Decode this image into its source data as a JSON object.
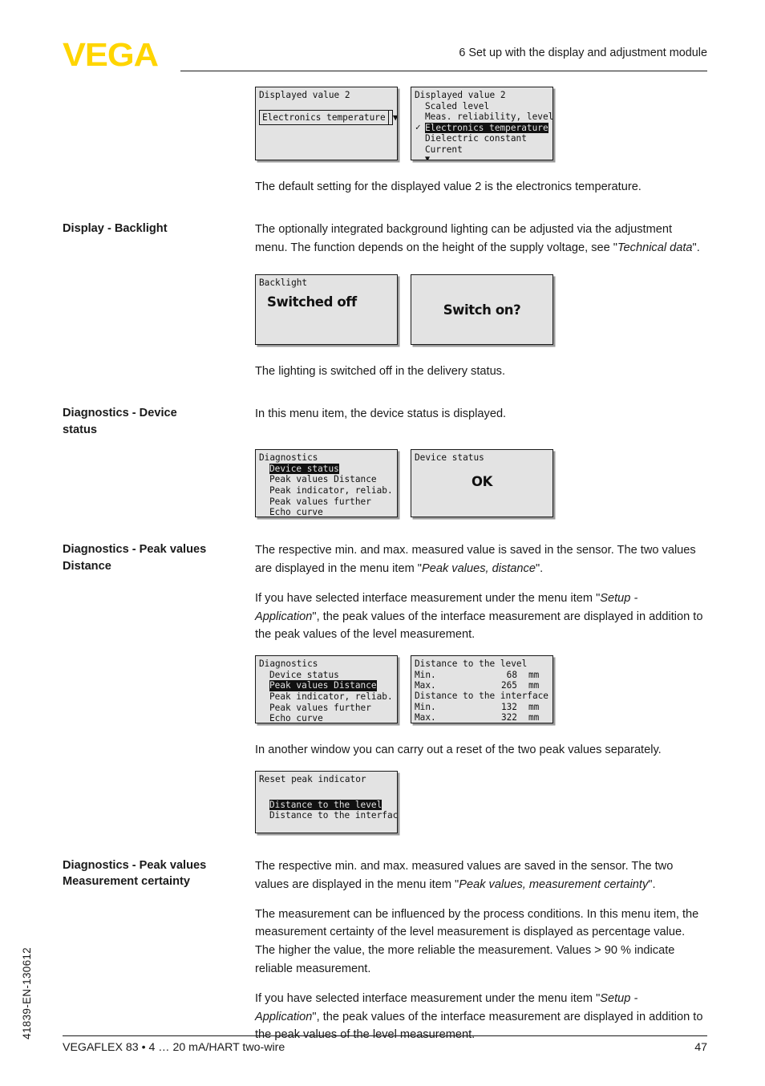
{
  "header": {
    "logo": "VEGA",
    "chapter_title": "6 Set up with the display and adjustment module"
  },
  "doc_number": "41839-EN-130612",
  "footer": {
    "product": "VEGAFLEX 83 • 4 … 20 mA/HART two-wire",
    "page_number": "47"
  },
  "sections": {
    "displayed_value": {
      "lcd_closed": {
        "title": "Displayed value 2",
        "selected_value": "Electronics temperature",
        "arrow": "▼"
      },
      "lcd_open": {
        "title": "Displayed value 2",
        "items": [
          "Scaled level",
          "Meas. reliability, level",
          "Electronics temperature",
          "Dielectric constant",
          "Current"
        ],
        "selected_index": 2,
        "more_arrow": "▼"
      },
      "body": "The default setting for the displayed value 2 is the electronics temperature."
    },
    "backlight": {
      "label": "Display - Backlight",
      "body_before": "The optionally integrated background lighting can be adjusted via the adjustment menu. The function depends on the height of the supply voltage, see \"",
      "body_italic": "Technical data",
      "body_after": "\".",
      "lcd_left": {
        "title": "Backlight",
        "value": "Switched off"
      },
      "lcd_right": {
        "value": "Switch on?"
      },
      "body_after_lcd": "The lighting is switched off in the delivery status."
    },
    "device_status": {
      "label_line1": "Diagnostics - Device",
      "label_line2": "status",
      "body": "In this menu item, the device status is displayed.",
      "lcd_menu": {
        "title": "Diagnostics",
        "items": [
          "Device status",
          "Peak values Distance",
          "Peak indicator, reliab.",
          "Peak values further",
          "Echo curve"
        ],
        "selected_index": 0,
        "more_arrow": "▼"
      },
      "lcd_status": {
        "title": "Device status",
        "value": "OK"
      }
    },
    "peak_values_distance": {
      "label_line1": "Diagnostics - Peak values",
      "label_line2": "Distance",
      "para1_a": "The respective min. and max. measured value is saved in the sensor. The two values are displayed in the menu item \"",
      "para1_i": "Peak values, distance",
      "para1_b": "\".",
      "para2_a": "If you have selected interface measurement under the menu item \"",
      "para2_i": "Setup - Application",
      "para2_b": "\", the peak values of the interface measurement are displayed in addition to the peak values of the level measurement.",
      "lcd_menu": {
        "title": "Diagnostics",
        "items": [
          "Device status",
          "Peak values Distance",
          "Peak indicator, reliab.",
          "Peak values further",
          "Echo curve"
        ],
        "selected_index": 1,
        "more_arrow": "▼"
      },
      "lcd_values": {
        "group1_title": "Distance to the level",
        "group1_rows": [
          {
            "label": "Min.",
            "value": "68",
            "unit": "mm"
          },
          {
            "label": "Max.",
            "value": "265",
            "unit": "mm"
          }
        ],
        "group2_title": "Distance to the interface",
        "group2_rows": [
          {
            "label": "Min.",
            "value": "132",
            "unit": "mm"
          },
          {
            "label": "Max.",
            "value": "322",
            "unit": "mm"
          }
        ]
      },
      "para3": "In another window you can carry out a reset of the two peak values separately.",
      "lcd_reset": {
        "title": "Reset peak indicator",
        "items": [
          "Distance to the level",
          "Distance to the interface"
        ],
        "selected_index": 0
      }
    },
    "measurement_certainty": {
      "label_line1": "Diagnostics - Peak values",
      "label_line2": "Measurement certainty",
      "para1_a": "The respective min. and max. measured values are saved in the sensor. The two values are displayed in the menu item \"",
      "para1_i": "Peak values, measurement certainty",
      "para1_b": "\".",
      "para2": "The measurement can be influenced by the process conditions. In this menu item, the measurement certainty of the level measurement is displayed as percentage value. The higher the value, the more reliable the measurement. Values > 90 % indicate reliable measurement.",
      "para3_a": "If you have selected interface measurement under the menu item \"",
      "para3_i": "Setup - Application",
      "para3_b": "\", the peak values of the interface measurement are displayed in addition to the peak values of the level measurement."
    }
  }
}
